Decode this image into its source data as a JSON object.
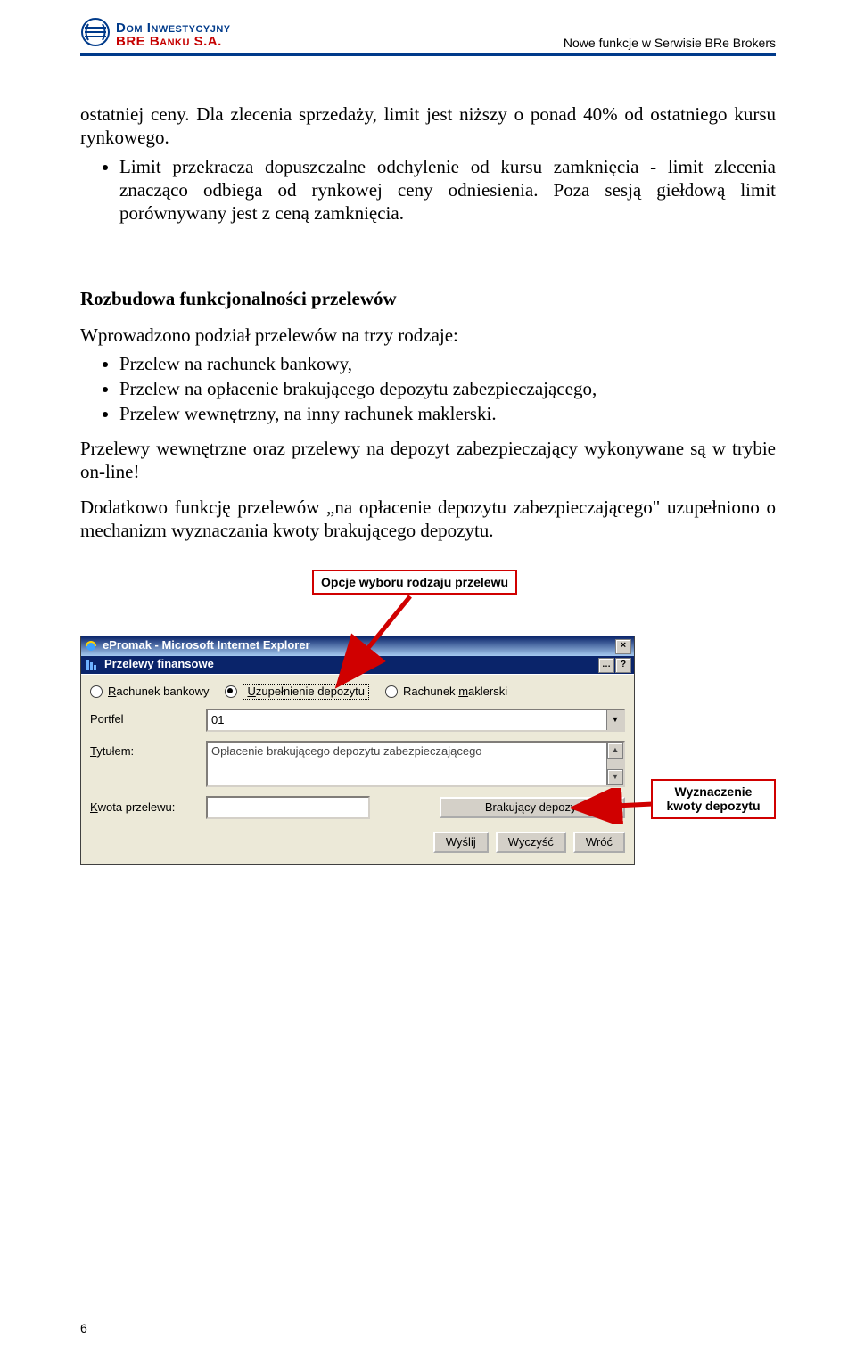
{
  "header": {
    "brand_line1": "Dom Inwestycyjny",
    "brand_line2": "BRE Banku S.A.",
    "right_text": "Nowe funkcje w Serwisie BRe Brokers"
  },
  "body": {
    "para1": "ostatniej ceny. Dla zlecenia sprzedaży, limit jest niższy o ponad 40% od ostatniego kursu rynkowego.",
    "bullet_upper": "Limit przekracza dopuszczalne odchylenie od kursu zamknięcia -  limit zlecenia znacząco odbiega od rynkowej ceny odniesienia. Poza sesją giełdową limit porównywany jest z ceną zamknięcia.",
    "heading2": "Rozbudowa funkcjonalności przelewów",
    "intro2": "Wprowadzono podział przelewów na trzy rodzaje:",
    "bullets": [
      "Przelew na rachunek bankowy,",
      "Przelew na opłacenie brakującego depozytu zabezpieczającego,",
      "Przelew wewnętrzny, na inny rachunek maklerski."
    ],
    "para2": "Przelewy wewnętrzne oraz przelewy na depozyt zabezpieczający wykonywane są w trybie on-line!",
    "para3": "Dodatkowo funkcję przelewów „na opłacenie depozytu zabezpieczającego\" uzupełniono o mechanizm wyznaczania kwoty brakującego depozytu."
  },
  "callouts": {
    "top": "Opcje wyboru rodzaju przelewu",
    "right": "Wyznaczenie kwoty depozytu"
  },
  "window": {
    "ie_title": "ePromak - Microsoft Internet Explorer",
    "sub_title": "Przelewy finansowe",
    "close_glyph": "×",
    "dots_glyph": "…",
    "help_glyph": "?",
    "radio1_u": "R",
    "radio1_rest": "achunek bankowy",
    "radio2_u": "U",
    "radio2_rest": "zupełnienie depozytu",
    "radio3_rest_pre": "Rachunek",
    "radio3_u": "m",
    "radio3_rest_post": "aklerski",
    "lbl_portfel": "Portfel",
    "val_portfel": "01",
    "lbl_tytulem_u": "T",
    "lbl_tytulem_rest": "ytułem:",
    "val_tytulem": "Opłacenie brakującego depozytu zabezpieczającego",
    "lbl_kwota_u": "K",
    "lbl_kwota_rest": "wota przelewu:",
    "btn_brakujacy": "Brakujący depozyt",
    "btn_wyslij": "Wyślij",
    "btn_wyczysc": "Wyczyść",
    "btn_wroc": "Wróć"
  },
  "footer": {
    "page_number": "6"
  }
}
